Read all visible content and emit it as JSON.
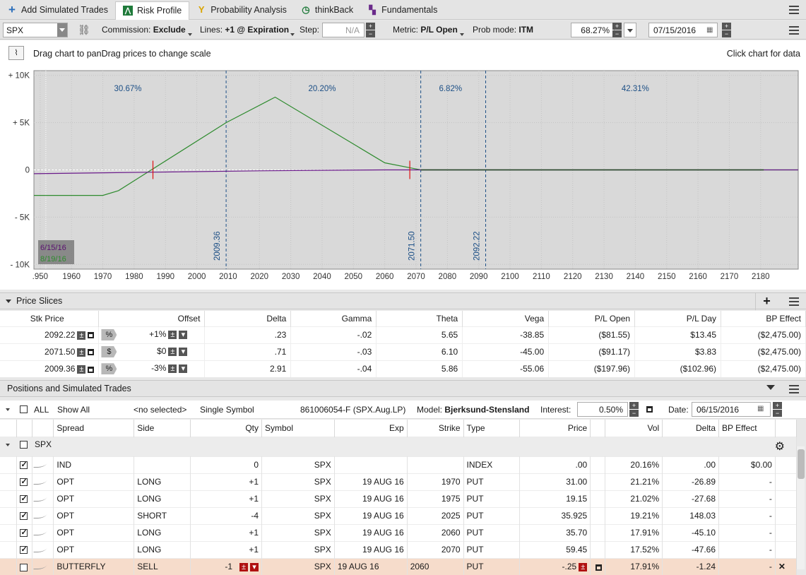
{
  "tabs": [
    {
      "label": "Add Simulated Trades",
      "icon": "plus-icon",
      "color": "#2a6ebb"
    },
    {
      "label": "Risk Profile",
      "icon": "risk-profile-icon",
      "color": "#1f7a3a"
    },
    {
      "label": "Probability Analysis",
      "icon": "probability-icon",
      "color": "#d9a400"
    },
    {
      "label": "thinkBack",
      "icon": "clock-icon",
      "color": "#1f7a3a"
    },
    {
      "label": "Fundamentals",
      "icon": "fundamentals-icon",
      "color": "#6a2a8a"
    }
  ],
  "settings": {
    "symbol": "SPX",
    "commission_label": "Commission:",
    "commission_value": "Exclude",
    "lines_label": "Lines:",
    "lines_value": "+1 @ Expiration",
    "step_label": "Step:",
    "step_value": "N/A",
    "metric_label": "Metric:",
    "metric_value": "P/L Open",
    "prob_label": "Prob mode:",
    "prob_value": "ITM",
    "prob_pct": "68.27%",
    "date_value": "07/15/2016"
  },
  "info": {
    "hint": "Drag chart to panDrag prices to change scale",
    "click_hint": "Click chart for data"
  },
  "chart_data": {
    "type": "line",
    "title": "",
    "xlabel": "",
    "ylabel": "",
    "xlim": [
      1948,
      2192
    ],
    "ylim": [
      -10500,
      10500
    ],
    "x_ticks": [
      1950,
      1960,
      1970,
      1980,
      1990,
      2000,
      2010,
      2020,
      2030,
      2040,
      2050,
      2060,
      2070,
      2080,
      2090,
      2100,
      2110,
      2120,
      2130,
      2140,
      2150,
      2160,
      2170,
      2180
    ],
    "x_tick_labels": [
      ".950",
      "1960",
      "1970",
      "1980",
      "1990",
      "2000",
      "2010",
      "2020",
      "2030",
      "2040",
      "2050",
      "2060",
      "2070",
      "2080",
      "2090",
      "2100",
      "2110",
      "2120",
      "2130",
      "2140",
      "2150",
      "2160",
      "2170",
      "2180"
    ],
    "y_ticks": [
      10000,
      5000,
      0,
      -5000,
      -10000
    ],
    "y_tick_labels": [
      "+ 10K",
      "+ 5K",
      "0",
      "- 5K",
      "- 10K"
    ],
    "series": [
      {
        "name": "8/19/16",
        "color": "#2e8b2e",
        "x": [
          1948,
          1970,
          1975,
          2009.36,
          2025,
          2060,
          2070,
          2071.5,
          2192
        ],
        "y": [
          -2700,
          -2700,
          -2200,
          5000,
          7700,
          750,
          100,
          0,
          0
        ]
      },
      {
        "name": "6/15/16",
        "color": "#6a1a8a",
        "x": [
          1948,
          1985,
          2020,
          2060,
          2071.5,
          2192
        ],
        "y": [
          -400,
          -250,
          -100,
          0,
          0,
          0
        ]
      }
    ],
    "vlines": [
      {
        "x": 2009.36,
        "label": "2009.36"
      },
      {
        "x": 2071.5,
        "label": "2071.50"
      },
      {
        "x": 2092.22,
        "label": "2092.22"
      }
    ],
    "regions": [
      {
        "x": 1978,
        "label": "30.67%"
      },
      {
        "x": 2040,
        "label": "20.20%"
      },
      {
        "x": 2081,
        "label": "6.82%"
      },
      {
        "x": 2140,
        "label": "42.31%"
      }
    ],
    "breakevens": [
      1986,
      2068
    ],
    "legend": [
      "6/15/16",
      "8/19/16"
    ],
    "legend_position": "bottom-left",
    "grid": true
  },
  "price_slices": {
    "title": "Price Slices",
    "columns": [
      "Stk Price",
      "Offset",
      "Delta",
      "Gamma",
      "Theta",
      "Vega",
      "P/L Open",
      "P/L Day",
      "BP Effect"
    ],
    "rows": [
      {
        "price": "2092.22",
        "mode": "%",
        "offset": "+1%",
        "delta": ".23",
        "gamma": "-.02",
        "theta": "5.65",
        "vega": "-38.85",
        "pl_open": "($81.55)",
        "pl_day": "$13.45",
        "bp": "($2,475.00)"
      },
      {
        "price": "2071.50",
        "mode": "$",
        "offset": "$0",
        "delta": ".71",
        "gamma": "-.03",
        "theta": "6.10",
        "vega": "-45.00",
        "pl_open": "($91.17)",
        "pl_day": "$3.83",
        "bp": "($2,475.00)"
      },
      {
        "price": "2009.36",
        "mode": "%",
        "offset": "-3%",
        "delta": "2.91",
        "gamma": "-.04",
        "theta": "5.86",
        "vega": "-55.06",
        "pl_open": "($197.96)",
        "pl_day": "($102.96)",
        "bp": "($2,475.00)"
      }
    ]
  },
  "positions": {
    "title": "Positions and Simulated Trades",
    "filter": {
      "all": "ALL",
      "show": "Show All",
      "selected": "<no selected>",
      "mode": "Single Symbol",
      "account": "861006054-F (SPX.Aug.LP)",
      "model_label": "Model:",
      "model_value": "Bjerksund-Stensland",
      "interest_label": "Interest:",
      "interest_value": "0.50%",
      "date_label": "Date:",
      "date_value": "06/15/2016"
    },
    "columns": [
      "Spread",
      "Side",
      "Qty",
      "Symbol",
      "Exp",
      "Strike",
      "Type",
      "Price",
      "Vol",
      "Delta",
      "BP Effect"
    ],
    "group": "SPX",
    "rows": [
      {
        "spread": "IND",
        "side": "",
        "qty": "0",
        "symbol": "SPX",
        "exp": "",
        "strike": "",
        "type": "INDEX",
        "price": ".00",
        "vol": "20.16%",
        "delta": ".00",
        "bp": "$0.00"
      },
      {
        "spread": "OPT",
        "side": "LONG",
        "qty": "+1",
        "symbol": "SPX",
        "exp": "19 AUG 16",
        "strike": "1970",
        "type": "PUT",
        "price": "31.00",
        "vol": "21.21%",
        "delta": "-26.89",
        "bp": "-"
      },
      {
        "spread": "OPT",
        "side": "LONG",
        "qty": "+1",
        "symbol": "SPX",
        "exp": "19 AUG 16",
        "strike": "1975",
        "type": "PUT",
        "price": "19.15",
        "vol": "21.02%",
        "delta": "-27.68",
        "bp": "-"
      },
      {
        "spread": "OPT",
        "side": "SHORT",
        "qty": "-4",
        "symbol": "SPX",
        "exp": "19 AUG 16",
        "strike": "2025",
        "type": "PUT",
        "price": "35.925",
        "vol": "19.21%",
        "delta": "148.03",
        "bp": "-"
      },
      {
        "spread": "OPT",
        "side": "LONG",
        "qty": "+1",
        "symbol": "SPX",
        "exp": "19 AUG 16",
        "strike": "2060",
        "type": "PUT",
        "price": "35.70",
        "vol": "17.91%",
        "delta": "-45.10",
        "bp": "-"
      },
      {
        "spread": "OPT",
        "side": "LONG",
        "qty": "+1",
        "symbol": "SPX",
        "exp": "19 AUG 16",
        "strike": "2070",
        "type": "PUT",
        "price": "59.45",
        "vol": "17.52%",
        "delta": "-47.66",
        "bp": "-"
      },
      {
        "spread": "BUTTERFLY",
        "side": "SELL",
        "qty": "-1",
        "symbol": "SPX",
        "exp": "19 AUG 16",
        "strike": "2060",
        "type": "PUT",
        "price": "-.25",
        "vol": "17.91%",
        "delta": "-1.24",
        "bp": "-"
      }
    ]
  }
}
